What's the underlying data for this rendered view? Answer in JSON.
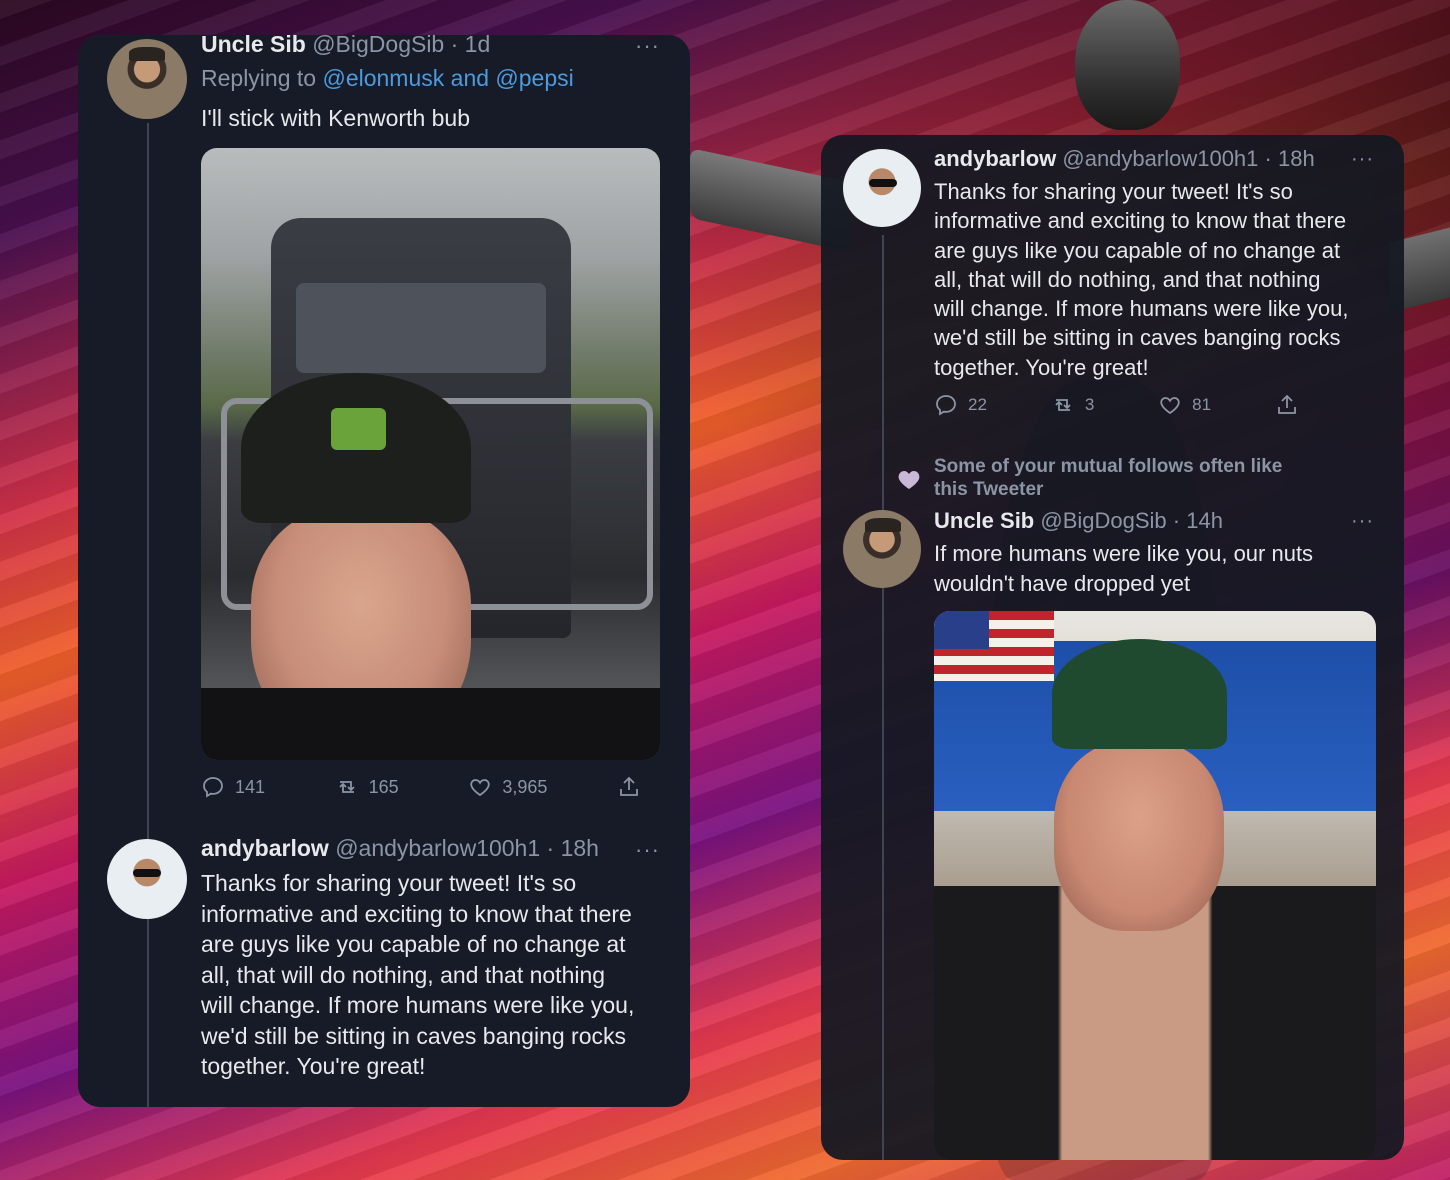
{
  "left": {
    "tweet1": {
      "name": "Uncle Sib",
      "handle": "@BigDogSib",
      "time": "· 1d",
      "more": "···",
      "reply_prefix": "Replying to",
      "reply_to_1": "@elonmusk",
      "reply_and": "and",
      "reply_to_2": "@pepsi",
      "text": "I'll stick with Kenworth bub",
      "replies": "141",
      "retweets": "165",
      "likes": "3,965"
    },
    "tweet2": {
      "name": "andybarlow",
      "handle": "@andybarlow100h1",
      "time": "· 18h",
      "more": "···",
      "text_lines": [
        "Thanks for sharing your tweet! It's so",
        "informative and exciting to know that there",
        "are guys like you capable of no change at",
        "all, that will do nothing, and that nothing",
        "will change. If more humans were like you,",
        "we'd still be sitting in caves banging rocks",
        "together. You're great!"
      ]
    }
  },
  "right": {
    "tweet1": {
      "name": "andybarlow",
      "handle": "@andybarlow100h1",
      "time": "· 18h",
      "more": "···",
      "text_lines": [
        "Thanks for sharing your tweet! It's so",
        "informative and exciting to know that there",
        "are guys like you capable of no change at",
        "all, that will do nothing, and that nothing",
        "will change. If more humans were like you,",
        "we'd still be sitting in caves banging rocks",
        "together. You're great!"
      ],
      "replies": "22",
      "retweets": "3",
      "likes": "81"
    },
    "mutual_note": [
      "Some of your mutual follows often like",
      "this Tweeter"
    ],
    "tweet2": {
      "name": "Uncle Sib",
      "handle": "@BigDogSib",
      "time": "· 14h",
      "more": "···",
      "text_lines": [
        "If more humans were like you, our nuts",
        "wouldn't have dropped yet"
      ]
    }
  },
  "icons": {
    "reply": "reply-icon",
    "retweet": "retweet-icon",
    "like": "like-icon",
    "share": "share-icon"
  },
  "colors": {
    "panel_bg": "#161b27",
    "text": "#e7e9ec",
    "muted": "#8b95a5",
    "link": "#4a9be0"
  }
}
